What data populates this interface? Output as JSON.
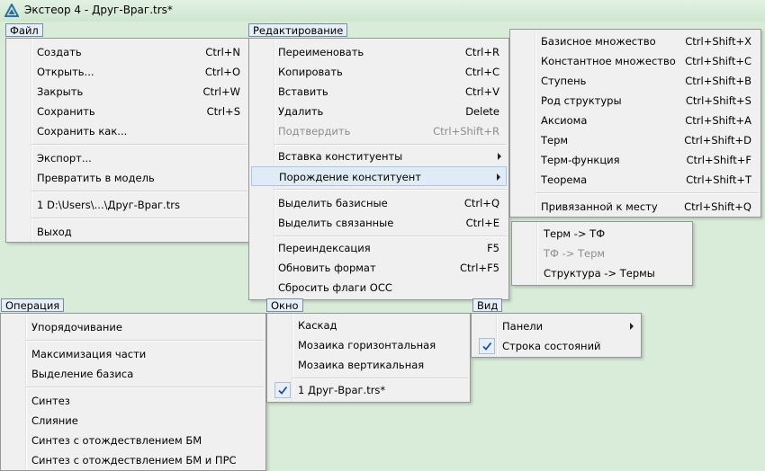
{
  "window": {
    "title": "Экстеор 4 - Друг-Враг.trs*"
  },
  "menus": {
    "file": {
      "header": "Файл",
      "items": [
        {
          "label": "Создать",
          "shortcut": "Ctrl+N"
        },
        {
          "label": "Открыть...",
          "shortcut": "Ctrl+O"
        },
        {
          "label": "Закрыть",
          "shortcut": "Ctrl+W"
        },
        {
          "label": "Сохранить",
          "shortcut": "Ctrl+S"
        },
        {
          "label": "Сохранить как...",
          "shortcut": ""
        },
        {
          "label": "Экспорт...",
          "shortcut": ""
        },
        {
          "label": "Превратить в модель",
          "shortcut": ""
        },
        {
          "label": "1 D:\\Users\\...\\Друг-Враг.trs",
          "shortcut": ""
        },
        {
          "label": "Выход",
          "shortcut": ""
        }
      ]
    },
    "edit": {
      "header": "Редактирование",
      "items": [
        {
          "label": "Переименовать",
          "shortcut": "Ctrl+R"
        },
        {
          "label": "Копировать",
          "shortcut": "Ctrl+C"
        },
        {
          "label": "Вставить",
          "shortcut": "Ctrl+V"
        },
        {
          "label": "Удалить",
          "shortcut": "Delete"
        },
        {
          "label": "Подтвердить",
          "shortcut": "Ctrl+Shift+R",
          "disabled": true
        },
        {
          "label": "Вставка конституенты",
          "shortcut": "",
          "submenu": true
        },
        {
          "label": "Порождение конституент",
          "shortcut": "",
          "submenu": true,
          "highlighted": true
        },
        {
          "label": "Выделить базисные",
          "shortcut": "Ctrl+Q"
        },
        {
          "label": "Выделить связанные",
          "shortcut": "Ctrl+E"
        },
        {
          "label": "Переиндексация",
          "shortcut": "F5"
        },
        {
          "label": "Обновить формат",
          "shortcut": "Ctrl+F5"
        },
        {
          "label": "Сбросить флаги ОСС",
          "shortcut": ""
        }
      ]
    },
    "insert_submenu": {
      "items": [
        {
          "label": "Базисное множество",
          "shortcut": "Ctrl+Shift+X"
        },
        {
          "label": "Константное множество",
          "shortcut": "Ctrl+Shift+C"
        },
        {
          "label": "Ступень",
          "shortcut": "Ctrl+Shift+B"
        },
        {
          "label": "Род структуры",
          "shortcut": "Ctrl+Shift+S"
        },
        {
          "label": "Аксиома",
          "shortcut": "Ctrl+Shift+A"
        },
        {
          "label": "Терм",
          "shortcut": "Ctrl+Shift+D"
        },
        {
          "label": "Терм-функция",
          "shortcut": "Ctrl+Shift+F"
        },
        {
          "label": "Теорема",
          "shortcut": "Ctrl+Shift+T"
        },
        {
          "label": "Привязанной к месту",
          "shortcut": "Ctrl+Shift+Q"
        }
      ]
    },
    "generate_submenu": {
      "items": [
        {
          "label": "Терм -> ТФ",
          "disabled": false
        },
        {
          "label": "ТФ -> Терм",
          "disabled": true
        },
        {
          "label": "Структура -> Термы",
          "disabled": false
        }
      ]
    },
    "operation": {
      "header": "Операция",
      "items": [
        {
          "label": "Упорядочивание"
        },
        {
          "label": "Максимизация части"
        },
        {
          "label": "Выделение базиса"
        },
        {
          "label": "Синтез"
        },
        {
          "label": "Слияние"
        },
        {
          "label": "Синтез с отождествлением БМ"
        },
        {
          "label": "Синтез с отождествлением БМ и ПРС"
        }
      ]
    },
    "window_menu": {
      "header": "Окно",
      "items": [
        {
          "label": "Каскад"
        },
        {
          "label": "Мозаика горизонтальная"
        },
        {
          "label": "Мозаика вертикальная"
        },
        {
          "label": "1 Друг-Враг.trs*",
          "checked": true
        }
      ]
    },
    "view": {
      "header": "Вид",
      "items": [
        {
          "label": "Панели",
          "submenu": true
        },
        {
          "label": "Строка состояний",
          "checked": true
        }
      ]
    }
  },
  "icons": {
    "app": "exteor-triangle-icon",
    "submenu_arrow": "submenu-arrow-icon",
    "check": "checkmark-icon"
  },
  "colors": {
    "background": "#d9ecd9",
    "menu_bg": "#f0f0f0",
    "highlight_bg": "#e1ebf7",
    "highlight_border": "#a8c4e6",
    "disabled_text": "#8d8d8d",
    "check_blue": "#1f4f9c",
    "app_icon": "#2b6fa8"
  }
}
